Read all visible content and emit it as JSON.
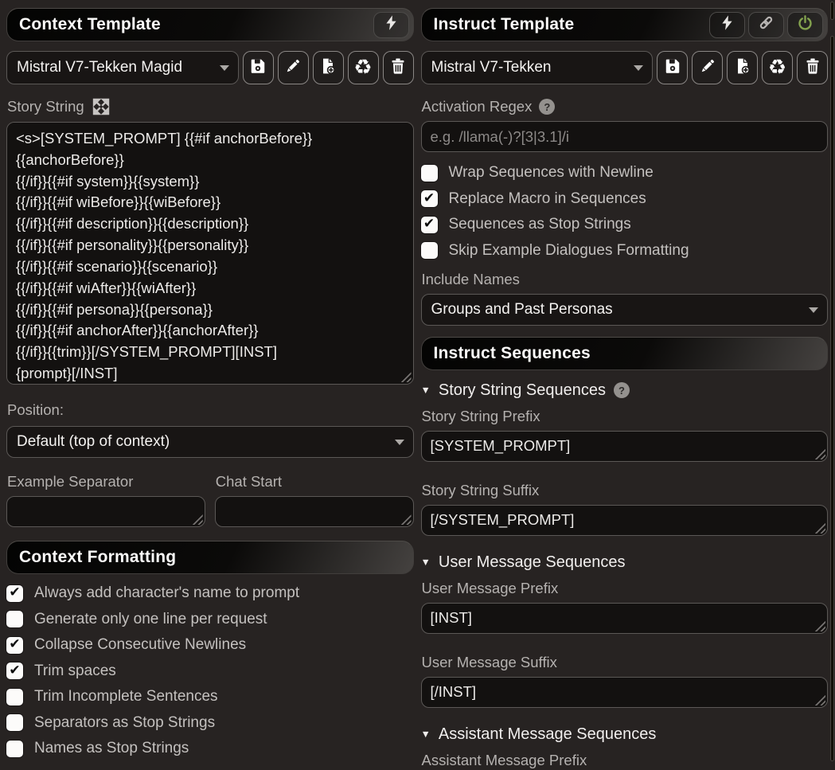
{
  "colors": {
    "power_active_green": "#83a24e",
    "background": "#272322",
    "accent_text": "#c4c1bf"
  },
  "left_panel": {
    "title": "Context Template",
    "preset": {
      "value": "Mistral V7-Tekken Magid"
    },
    "story_string": {
      "label": "Story String",
      "value": "<s>[SYSTEM_PROMPT] {{#if anchorBefore}}\n{{anchorBefore}}\n{{/if}}{{#if system}}{{system}}\n{{/if}}{{#if wiBefore}}{{wiBefore}}\n{{/if}}{{#if description}}{{description}}\n{{/if}}{{#if personality}}{{personality}}\n{{/if}}{{#if scenario}}{{scenario}}\n{{/if}}{{#if wiAfter}}{{wiAfter}}\n{{/if}}{{#if persona}}{{persona}}\n{{/if}}{{#if anchorAfter}}{{anchorAfter}}\n{{/if}}{{trim}}[/SYSTEM_PROMPT][INST]\n{prompt}[/INST]"
    },
    "position": {
      "label": "Position:",
      "value": "Default (top of context)"
    },
    "example_separator": {
      "label": "Example Separator",
      "value": ""
    },
    "chat_start": {
      "label": "Chat Start",
      "value": ""
    },
    "context_formatting": {
      "title": "Context Formatting",
      "items": [
        {
          "label": "Always add character's name to prompt",
          "checked": true
        },
        {
          "label": "Generate only one line per request",
          "checked": false
        },
        {
          "label": "Collapse Consecutive Newlines",
          "checked": true
        },
        {
          "label": "Trim spaces",
          "checked": true
        },
        {
          "label": "Trim Incomplete Sentences",
          "checked": false
        },
        {
          "label": "Separators as Stop Strings",
          "checked": false
        },
        {
          "label": "Names as Stop Strings",
          "checked": false
        }
      ]
    }
  },
  "right_panel": {
    "title": "Instruct Template",
    "preset": {
      "value": "Mistral V7-Tekken"
    },
    "activation_regex": {
      "label": "Activation Regex",
      "placeholder": "e.g. /llama(-)?[3|3.1]/i",
      "value": ""
    },
    "options": [
      {
        "label": "Wrap Sequences with Newline",
        "checked": false
      },
      {
        "label": "Replace Macro in Sequences",
        "checked": true
      },
      {
        "label": "Sequences as Stop Strings",
        "checked": true
      },
      {
        "label": "Skip Example Dialogues Formatting",
        "checked": false
      }
    ],
    "include_names": {
      "label": "Include Names",
      "value": "Groups and Past Personas"
    },
    "instruct_sequences": {
      "title": "Instruct Sequences",
      "sections": [
        {
          "title": "Story String Sequences",
          "fields": [
            {
              "label": "Story String Prefix",
              "value": "[SYSTEM_PROMPT]"
            },
            {
              "label": "Story String Suffix",
              "value": "[/SYSTEM_PROMPT]"
            }
          ]
        },
        {
          "title": "User Message Sequences",
          "fields": [
            {
              "label": "User Message Prefix",
              "value": "[INST]"
            },
            {
              "label": "User Message Suffix",
              "value": "[/INST]"
            }
          ]
        },
        {
          "title": "Assistant Message Sequences",
          "fields": [
            {
              "label": "Assistant Message Prefix",
              "value": ""
            }
          ]
        }
      ]
    }
  }
}
